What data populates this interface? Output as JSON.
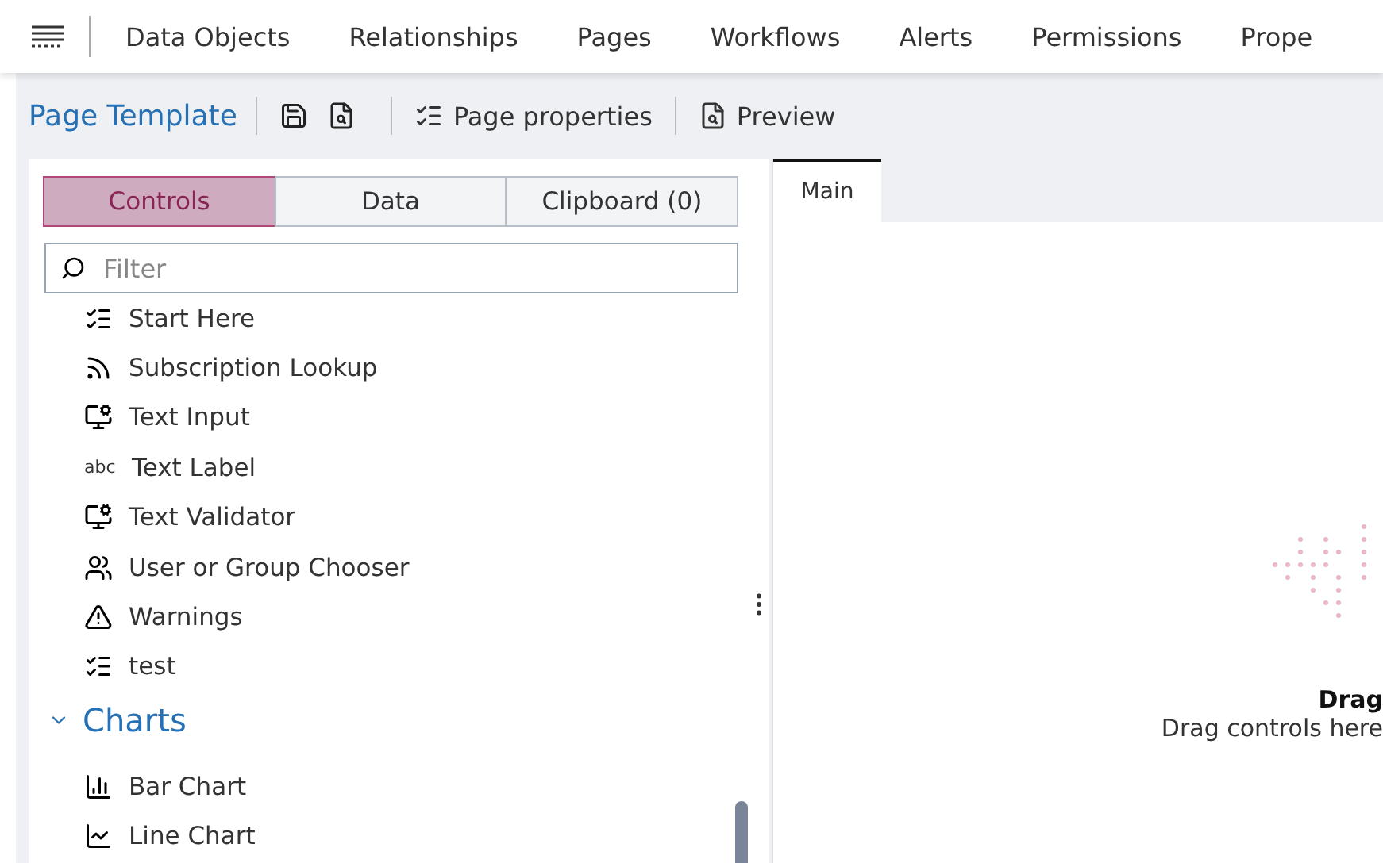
{
  "nav": {
    "items": [
      {
        "label": "Data Objects"
      },
      {
        "label": "Relationships"
      },
      {
        "label": "Pages"
      },
      {
        "label": "Workflows"
      },
      {
        "label": "Alerts"
      },
      {
        "label": "Permissions"
      },
      {
        "label": "Prope"
      }
    ]
  },
  "toolbar": {
    "title": "Page Template",
    "buttons": [
      {
        "label": "Page properties",
        "kind": "properties"
      },
      {
        "label": "Preview",
        "kind": "preview"
      }
    ]
  },
  "panel_tabs": [
    {
      "label": "Controls",
      "selected": true
    },
    {
      "label": "Data",
      "selected": false
    },
    {
      "label": "Clipboard (0)",
      "selected": false
    }
  ],
  "filter": {
    "placeholder": "Filter"
  },
  "controls": [
    {
      "label": "Start Here",
      "kind": "form"
    },
    {
      "label": "Subscription Lookup",
      "kind": "feed"
    },
    {
      "label": "Text Input",
      "kind": "input"
    },
    {
      "label": "Text Label",
      "kind": "glyph",
      "glyph": "abc"
    },
    {
      "label": "Text Validator",
      "kind": "input"
    },
    {
      "label": "User or Group Chooser",
      "kind": "users"
    },
    {
      "label": "Warnings",
      "kind": "warning"
    },
    {
      "label": "test",
      "kind": "form"
    }
  ],
  "section": {
    "title": "Charts",
    "expanded": true,
    "items": [
      {
        "label": "Bar Chart",
        "kind": "bar"
      },
      {
        "label": "Line Chart",
        "kind": "line"
      }
    ]
  },
  "canvas_tabs": [
    {
      "label": "Main",
      "selected": true
    }
  ],
  "drop_zone": {
    "title": "Drag",
    "hint": "Drag controls here"
  }
}
